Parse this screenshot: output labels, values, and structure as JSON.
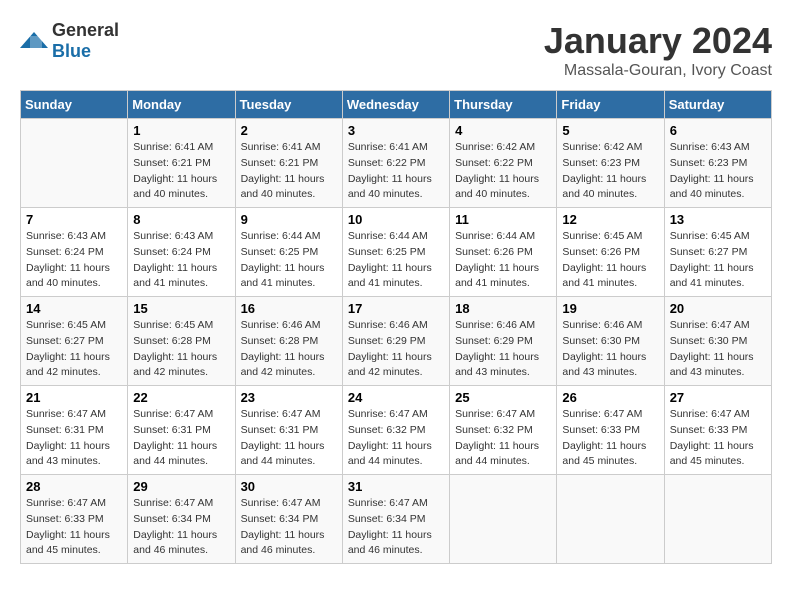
{
  "logo": {
    "general": "General",
    "blue": "Blue"
  },
  "title": "January 2024",
  "location": "Massala-Gouran, Ivory Coast",
  "days_of_week": [
    "Sunday",
    "Monday",
    "Tuesday",
    "Wednesday",
    "Thursday",
    "Friday",
    "Saturday"
  ],
  "weeks": [
    [
      {
        "day": "",
        "sunrise": "",
        "sunset": "",
        "daylight": ""
      },
      {
        "day": "1",
        "sunrise": "Sunrise: 6:41 AM",
        "sunset": "Sunset: 6:21 PM",
        "daylight": "Daylight: 11 hours and 40 minutes."
      },
      {
        "day": "2",
        "sunrise": "Sunrise: 6:41 AM",
        "sunset": "Sunset: 6:21 PM",
        "daylight": "Daylight: 11 hours and 40 minutes."
      },
      {
        "day": "3",
        "sunrise": "Sunrise: 6:41 AM",
        "sunset": "Sunset: 6:22 PM",
        "daylight": "Daylight: 11 hours and 40 minutes."
      },
      {
        "day": "4",
        "sunrise": "Sunrise: 6:42 AM",
        "sunset": "Sunset: 6:22 PM",
        "daylight": "Daylight: 11 hours and 40 minutes."
      },
      {
        "day": "5",
        "sunrise": "Sunrise: 6:42 AM",
        "sunset": "Sunset: 6:23 PM",
        "daylight": "Daylight: 11 hours and 40 minutes."
      },
      {
        "day": "6",
        "sunrise": "Sunrise: 6:43 AM",
        "sunset": "Sunset: 6:23 PM",
        "daylight": "Daylight: 11 hours and 40 minutes."
      }
    ],
    [
      {
        "day": "7",
        "sunrise": "Sunrise: 6:43 AM",
        "sunset": "Sunset: 6:24 PM",
        "daylight": "Daylight: 11 hours and 40 minutes."
      },
      {
        "day": "8",
        "sunrise": "Sunrise: 6:43 AM",
        "sunset": "Sunset: 6:24 PM",
        "daylight": "Daylight: 11 hours and 41 minutes."
      },
      {
        "day": "9",
        "sunrise": "Sunrise: 6:44 AM",
        "sunset": "Sunset: 6:25 PM",
        "daylight": "Daylight: 11 hours and 41 minutes."
      },
      {
        "day": "10",
        "sunrise": "Sunrise: 6:44 AM",
        "sunset": "Sunset: 6:25 PM",
        "daylight": "Daylight: 11 hours and 41 minutes."
      },
      {
        "day": "11",
        "sunrise": "Sunrise: 6:44 AM",
        "sunset": "Sunset: 6:26 PM",
        "daylight": "Daylight: 11 hours and 41 minutes."
      },
      {
        "day": "12",
        "sunrise": "Sunrise: 6:45 AM",
        "sunset": "Sunset: 6:26 PM",
        "daylight": "Daylight: 11 hours and 41 minutes."
      },
      {
        "day": "13",
        "sunrise": "Sunrise: 6:45 AM",
        "sunset": "Sunset: 6:27 PM",
        "daylight": "Daylight: 11 hours and 41 minutes."
      }
    ],
    [
      {
        "day": "14",
        "sunrise": "Sunrise: 6:45 AM",
        "sunset": "Sunset: 6:27 PM",
        "daylight": "Daylight: 11 hours and 42 minutes."
      },
      {
        "day": "15",
        "sunrise": "Sunrise: 6:45 AM",
        "sunset": "Sunset: 6:28 PM",
        "daylight": "Daylight: 11 hours and 42 minutes."
      },
      {
        "day": "16",
        "sunrise": "Sunrise: 6:46 AM",
        "sunset": "Sunset: 6:28 PM",
        "daylight": "Daylight: 11 hours and 42 minutes."
      },
      {
        "day": "17",
        "sunrise": "Sunrise: 6:46 AM",
        "sunset": "Sunset: 6:29 PM",
        "daylight": "Daylight: 11 hours and 42 minutes."
      },
      {
        "day": "18",
        "sunrise": "Sunrise: 6:46 AM",
        "sunset": "Sunset: 6:29 PM",
        "daylight": "Daylight: 11 hours and 43 minutes."
      },
      {
        "day": "19",
        "sunrise": "Sunrise: 6:46 AM",
        "sunset": "Sunset: 6:30 PM",
        "daylight": "Daylight: 11 hours and 43 minutes."
      },
      {
        "day": "20",
        "sunrise": "Sunrise: 6:47 AM",
        "sunset": "Sunset: 6:30 PM",
        "daylight": "Daylight: 11 hours and 43 minutes."
      }
    ],
    [
      {
        "day": "21",
        "sunrise": "Sunrise: 6:47 AM",
        "sunset": "Sunset: 6:31 PM",
        "daylight": "Daylight: 11 hours and 43 minutes."
      },
      {
        "day": "22",
        "sunrise": "Sunrise: 6:47 AM",
        "sunset": "Sunset: 6:31 PM",
        "daylight": "Daylight: 11 hours and 44 minutes."
      },
      {
        "day": "23",
        "sunrise": "Sunrise: 6:47 AM",
        "sunset": "Sunset: 6:31 PM",
        "daylight": "Daylight: 11 hours and 44 minutes."
      },
      {
        "day": "24",
        "sunrise": "Sunrise: 6:47 AM",
        "sunset": "Sunset: 6:32 PM",
        "daylight": "Daylight: 11 hours and 44 minutes."
      },
      {
        "day": "25",
        "sunrise": "Sunrise: 6:47 AM",
        "sunset": "Sunset: 6:32 PM",
        "daylight": "Daylight: 11 hours and 44 minutes."
      },
      {
        "day": "26",
        "sunrise": "Sunrise: 6:47 AM",
        "sunset": "Sunset: 6:33 PM",
        "daylight": "Daylight: 11 hours and 45 minutes."
      },
      {
        "day": "27",
        "sunrise": "Sunrise: 6:47 AM",
        "sunset": "Sunset: 6:33 PM",
        "daylight": "Daylight: 11 hours and 45 minutes."
      }
    ],
    [
      {
        "day": "28",
        "sunrise": "Sunrise: 6:47 AM",
        "sunset": "Sunset: 6:33 PM",
        "daylight": "Daylight: 11 hours and 45 minutes."
      },
      {
        "day": "29",
        "sunrise": "Sunrise: 6:47 AM",
        "sunset": "Sunset: 6:34 PM",
        "daylight": "Daylight: 11 hours and 46 minutes."
      },
      {
        "day": "30",
        "sunrise": "Sunrise: 6:47 AM",
        "sunset": "Sunset: 6:34 PM",
        "daylight": "Daylight: 11 hours and 46 minutes."
      },
      {
        "day": "31",
        "sunrise": "Sunrise: 6:47 AM",
        "sunset": "Sunset: 6:34 PM",
        "daylight": "Daylight: 11 hours and 46 minutes."
      },
      {
        "day": "",
        "sunrise": "",
        "sunset": "",
        "daylight": ""
      },
      {
        "day": "",
        "sunrise": "",
        "sunset": "",
        "daylight": ""
      },
      {
        "day": "",
        "sunrise": "",
        "sunset": "",
        "daylight": ""
      }
    ]
  ]
}
